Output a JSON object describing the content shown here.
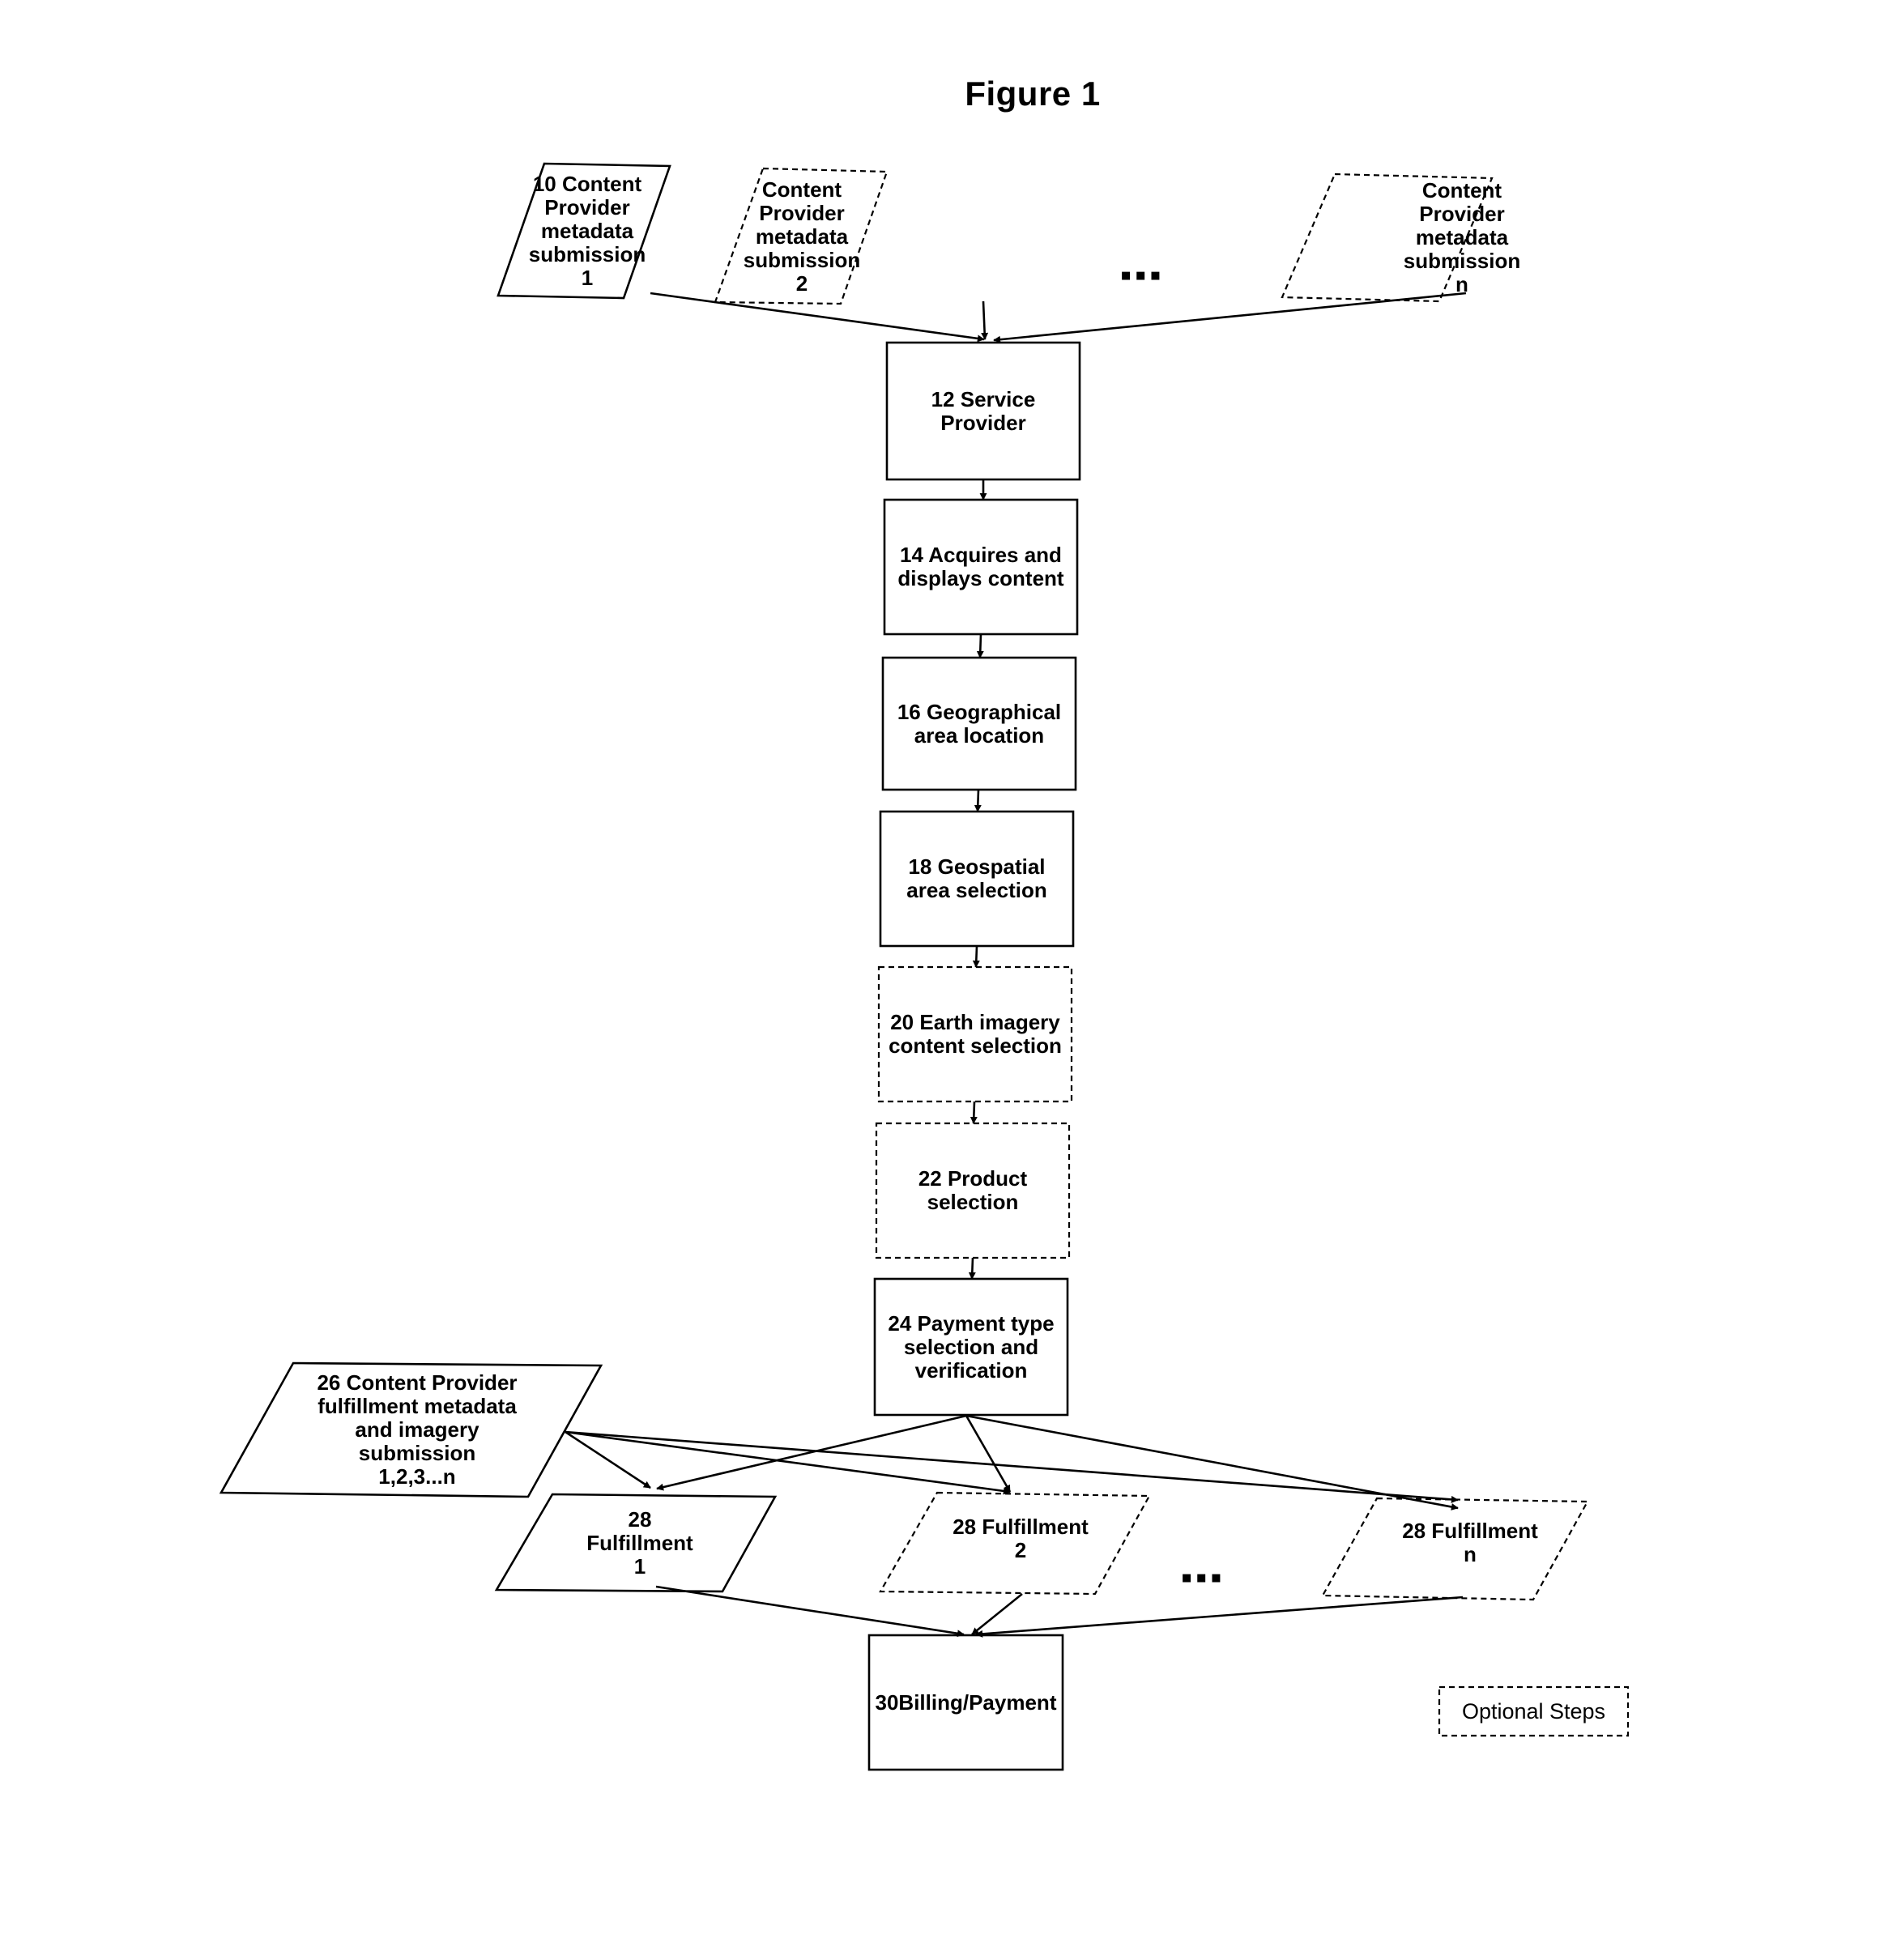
{
  "figure_title": "Figure 1",
  "colors": {
    "line": "#000000",
    "background": "#ffffff"
  },
  "nodes": {
    "n10": {
      "id": "10",
      "shape": "parallelogram",
      "optional": false,
      "label": "10 Content\nProvider\nmetadata\nsubmission\n1"
    },
    "n10b": {
      "id": "",
      "shape": "parallelogram",
      "optional": true,
      "label": "Content\nProvider\nmetadata\nsubmission\n2"
    },
    "n10n": {
      "id": "",
      "shape": "parallelogram",
      "optional": true,
      "label": "Content\nProvider\nmetadata\nsubmission\nn"
    },
    "n12": {
      "id": "12",
      "shape": "rect",
      "optional": false,
      "label": "12  Service\nProvider"
    },
    "n14": {
      "id": "14",
      "shape": "rect",
      "optional": false,
      "label": "14  Acquires and\ndisplays content"
    },
    "n16": {
      "id": "16",
      "shape": "rect",
      "optional": false,
      "label": "16  Geographical\narea location"
    },
    "n18": {
      "id": "18",
      "shape": "rect",
      "optional": false,
      "label": "18 Geospatial\narea selection"
    },
    "n20": {
      "id": "20",
      "shape": "rect",
      "optional": true,
      "label": "20 Earth imagery\ncontent selection"
    },
    "n22": {
      "id": "22",
      "shape": "rect",
      "optional": true,
      "label": "22   Product\nselection"
    },
    "n24": {
      "id": "24",
      "shape": "rect",
      "optional": false,
      "label": "24  Payment type\nselection and\nverification"
    },
    "n26": {
      "id": "26",
      "shape": "parallelogram",
      "optional": false,
      "label": "26 Content Provider\nfulfillment metadata\nand imagery\nsubmission\n1,2,3...n"
    },
    "n28a": {
      "id": "28",
      "shape": "parallelogram",
      "optional": false,
      "label": "28\nFulfillment\n1"
    },
    "n28b": {
      "id": "28",
      "shape": "parallelogram",
      "optional": true,
      "label": "28 Fulfillment\n2"
    },
    "n28n": {
      "id": "28",
      "shape": "parallelogram",
      "optional": true,
      "label": "28 Fulfillment\nn"
    },
    "n30": {
      "id": "30",
      "shape": "rect",
      "optional": false,
      "label": "30Billing/Payment"
    }
  },
  "ellipsis_top": "▪▪▪",
  "ellipsis_bottom": "▪▪▪",
  "legend": {
    "label": "Optional Steps",
    "style": "dashed"
  },
  "edges": [
    {
      "from": "n10",
      "to": "n12"
    },
    {
      "from": "n10b",
      "to": "n12"
    },
    {
      "from": "n10n",
      "to": "n12"
    },
    {
      "from": "n12",
      "to": "n14"
    },
    {
      "from": "n14",
      "to": "n16"
    },
    {
      "from": "n16",
      "to": "n18"
    },
    {
      "from": "n18",
      "to": "n20"
    },
    {
      "from": "n20",
      "to": "n22"
    },
    {
      "from": "n22",
      "to": "n24"
    },
    {
      "from": "n24",
      "to": "n28a"
    },
    {
      "from": "n24",
      "to": "n28b"
    },
    {
      "from": "n24",
      "to": "n28n"
    },
    {
      "from": "n26",
      "to": "n28a"
    },
    {
      "from": "n26",
      "to": "n28b"
    },
    {
      "from": "n26",
      "to": "n28n"
    },
    {
      "from": "n28a",
      "to": "n30"
    },
    {
      "from": "n28b",
      "to": "n30"
    },
    {
      "from": "n28n",
      "to": "n30"
    }
  ]
}
